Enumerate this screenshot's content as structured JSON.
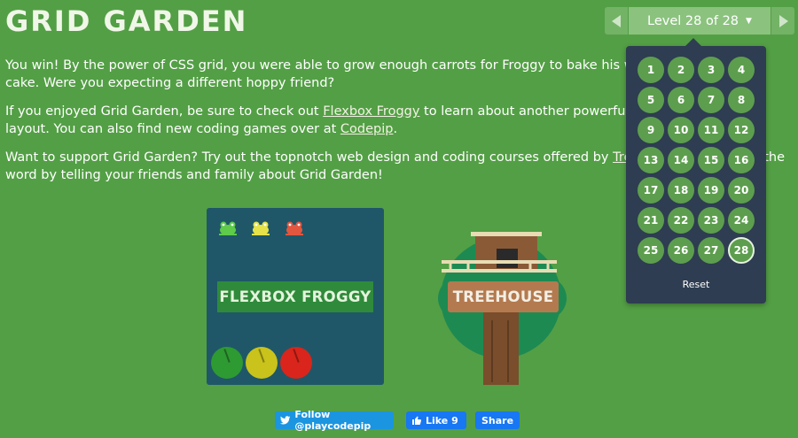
{
  "title": "GRID GARDEN",
  "paragraphs": {
    "p1": "You win! By the power of CSS grid, you were able to grow enough carrots for Froggy to bake his world famous carrot cake. Were you expecting a different hoppy friend?",
    "p2_before": "If you enjoyed Grid Garden, be sure to check out ",
    "p2_link": "Flexbox Froggy",
    "p2_after": " to learn about another powerful new feature of CSS layout. You can also find new coding games over at ",
    "p2_link2": "Codepip",
    "p2_end": ".",
    "p3_before": "Want to support Grid Garden? Try out the topnotch web design and coding courses offered by ",
    "p3_link": "Treehouse",
    "p3_after": ". And spread the word by telling your friends and family about Grid Garden!"
  },
  "level_nav": {
    "label": "Level 28 of 28",
    "current_level": 28,
    "levels": [
      "1",
      "2",
      "3",
      "4",
      "5",
      "6",
      "7",
      "8",
      "9",
      "10",
      "11",
      "12",
      "13",
      "14",
      "15",
      "16",
      "17",
      "18",
      "19",
      "20",
      "21",
      "22",
      "23",
      "24",
      "25",
      "26",
      "27",
      "28"
    ],
    "reset": "Reset"
  },
  "froggy_card": {
    "label": "FLEXBOX FROGGY"
  },
  "treehouse": {
    "label": "TREEHOUSE"
  },
  "social": {
    "twitter": "Follow @playcodepip",
    "like": "Like 9",
    "share": "Share"
  },
  "colors": {
    "background": "#539f45",
    "dropdown": "#2e3d51",
    "level_dot": "#5d9e4e",
    "card": "#1f5768",
    "frog_green": "#5ecb4a",
    "frog_yellow": "#e6e34a",
    "frog_red": "#e2563f"
  }
}
